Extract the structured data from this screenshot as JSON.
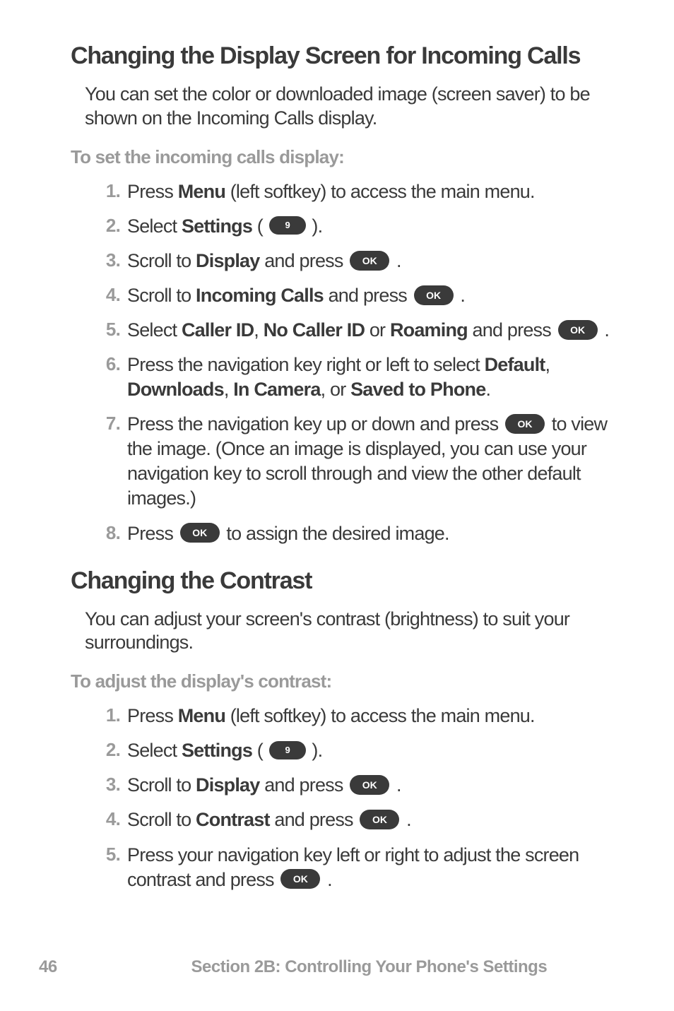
{
  "section1": {
    "heading": "Changing the Display Screen for Incoming Calls",
    "intro": "You can set the color or downloaded image (screen saver) to be shown on the Incoming Calls display.",
    "label": "To set the incoming calls display:",
    "steps": {
      "s1_pre": "Press ",
      "s1_bold": "Menu",
      "s1_post": " (left softkey) to access the main menu.",
      "s2_pre": "Select ",
      "s2_bold": "Settings",
      "s2_post_a": " ( ",
      "s2_post_b": " ).",
      "s3_pre": "Scroll to ",
      "s3_bold": "Display",
      "s3_mid": " and press ",
      "s3_post": " .",
      "s4_pre": "Scroll to ",
      "s4_bold": "Incoming Calls",
      "s4_mid": " and press ",
      "s4_post": " .",
      "s5_pre": "Select ",
      "s5_b1": "Caller ID",
      "s5_c1": ", ",
      "s5_b2": "No Caller ID",
      "s5_c2": " or ",
      "s5_b3": "Roaming",
      "s5_mid": " and press ",
      "s5_post": " .",
      "s6_pre": "Press the navigation key right or left to select ",
      "s6_b1": "Default",
      "s6_c1": ", ",
      "s6_b2": "Downloads",
      "s6_c2": ", ",
      "s6_b3": "In Camera",
      "s6_c3": ", or ",
      "s6_b4": "Saved to Phone",
      "s6_post": ".",
      "s7_pre": "Press the navigation key up or down and press ",
      "s7_post": " to view the image. (Once an image is displayed, you can use your navigation key to scroll through and view the other default images.)",
      "s8_pre": "Press ",
      "s8_post": " to assign the desired image."
    }
  },
  "section2": {
    "heading": "Changing the Contrast",
    "intro": "You can adjust your screen's contrast (brightness) to suit your surroundings.",
    "label": "To adjust the display's contrast:",
    "steps": {
      "s1_pre": "Press ",
      "s1_bold": "Menu",
      "s1_post": " (left softkey) to access the main menu.",
      "s2_pre": "Select ",
      "s2_bold": "Settings",
      "s2_post_a": " ( ",
      "s2_post_b": " ).",
      "s3_pre": "Scroll to ",
      "s3_bold": "Display",
      "s3_mid": " and press ",
      "s3_post": " .",
      "s4_pre": "Scroll to ",
      "s4_bold": "Contrast",
      "s4_mid": " and press ",
      "s4_post": " .",
      "s5_pre": "Press your navigation key left or right to adjust the screen contrast and press ",
      "s5_post": " ."
    }
  },
  "keys": {
    "nine": "9",
    "ok": "OK"
  },
  "footer": {
    "page": "46",
    "title": "Section 2B: Controlling Your Phone's Settings"
  }
}
